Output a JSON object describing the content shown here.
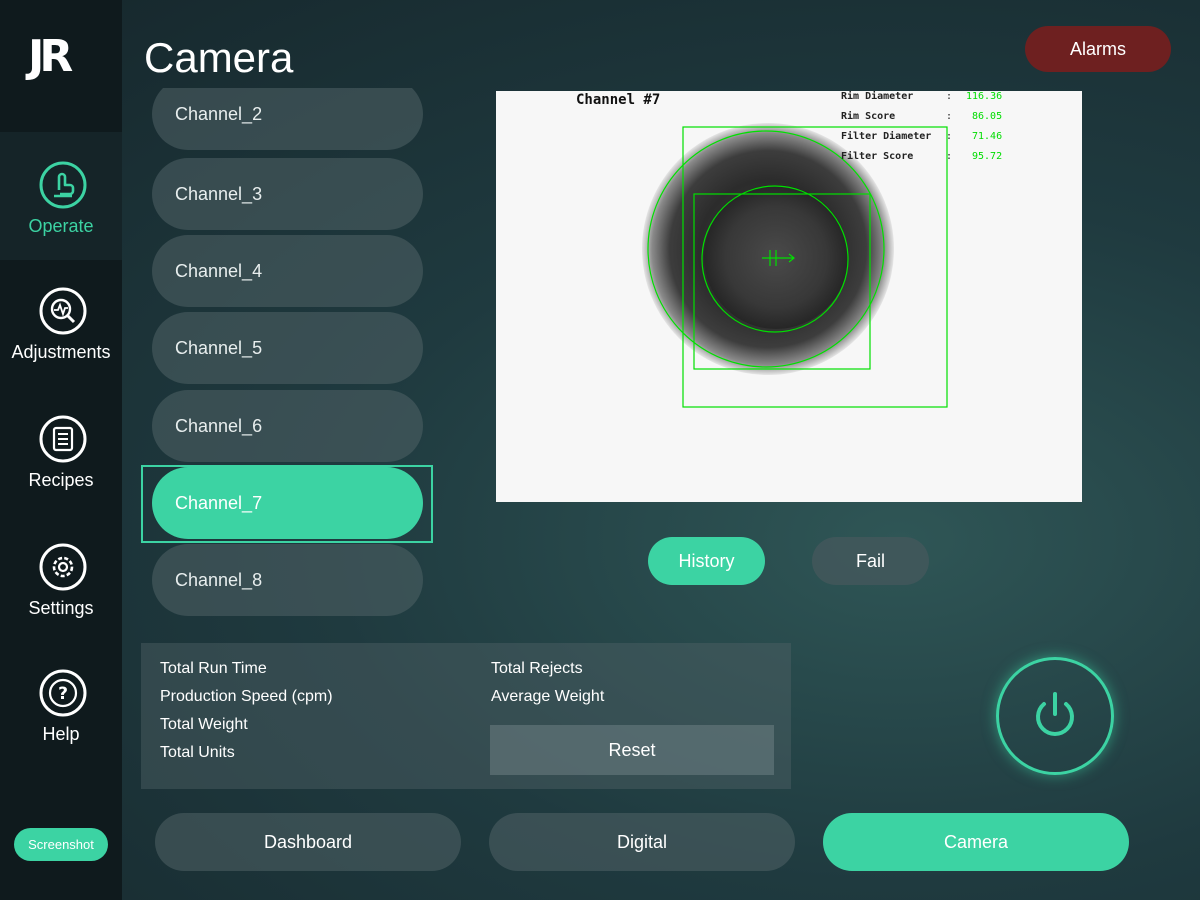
{
  "app": {
    "logo_text": "JR",
    "page_title": "Camera",
    "alarms_label": "Alarms",
    "screenshot_label": "Screenshot"
  },
  "sidebar": {
    "items": [
      {
        "label": "Operate",
        "icon": "hand-pointer-icon",
        "active": true
      },
      {
        "label": "Adjustments",
        "icon": "gauge-magnifier-icon",
        "active": false
      },
      {
        "label": "Recipes",
        "icon": "document-list-icon",
        "active": false
      },
      {
        "label": "Settings",
        "icon": "gear-icon",
        "active": false
      },
      {
        "label": "Help",
        "icon": "question-mark-icon",
        "active": false
      }
    ]
  },
  "channels": {
    "items": [
      "Channel_2",
      "Channel_3",
      "Channel_4",
      "Channel_5",
      "Channel_6",
      "Channel_7",
      "Channel_8"
    ],
    "selected": "Channel_7"
  },
  "camera": {
    "channel_title": "Channel #7",
    "readouts": [
      {
        "label": "Rim Diameter",
        "value": "116.36"
      },
      {
        "label": "Rim Score",
        "value": "86.05"
      },
      {
        "label": "Filter Diameter",
        "value": "71.46"
      },
      {
        "label": "Filter Score",
        "value": "95.72"
      }
    ],
    "overlay_color": "#00e000"
  },
  "view_buttons": {
    "history_label": "History",
    "fail_label": "Fail"
  },
  "stats": {
    "left": [
      "Total Run Time",
      "Production Speed (cpm)",
      "Total Weight",
      "Total Units"
    ],
    "right": [
      "Total Rejects",
      "Average Weight"
    ],
    "reset_label": "Reset"
  },
  "power": {
    "icon": "power-icon"
  },
  "bottom_tabs": [
    {
      "label": "Dashboard",
      "active": false
    },
    {
      "label": "Digital",
      "active": false
    },
    {
      "label": "Camera",
      "active": true
    }
  ],
  "colors": {
    "accent": "#3cd3a3",
    "alarm": "#6e2020",
    "sidebar_bg": "#0f1a1d"
  }
}
